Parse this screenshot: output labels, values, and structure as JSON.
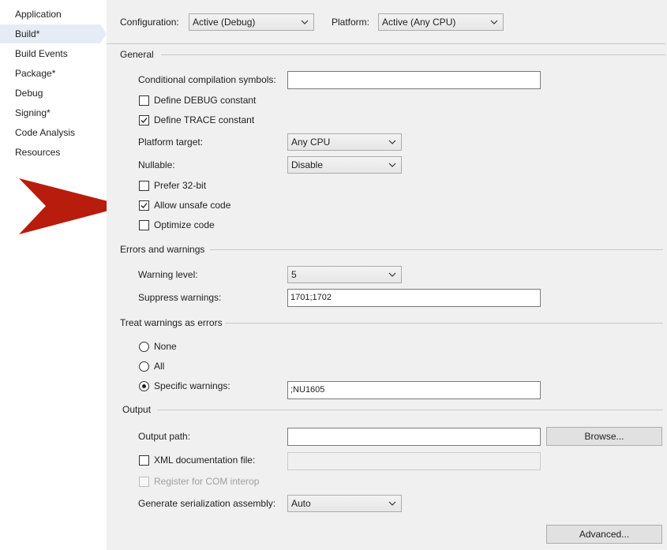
{
  "sidebar": {
    "items": [
      {
        "label": "Application"
      },
      {
        "label": "Build*"
      },
      {
        "label": "Build Events"
      },
      {
        "label": "Package*"
      },
      {
        "label": "Debug"
      },
      {
        "label": "Signing*"
      },
      {
        "label": "Code Analysis"
      },
      {
        "label": "Resources"
      }
    ],
    "selected_index": 1
  },
  "header": {
    "configuration_label": "Configuration:",
    "configuration_value": "Active (Debug)",
    "platform_label": "Platform:",
    "platform_value": "Active (Any CPU)"
  },
  "general": {
    "title": "General",
    "cond_symbols_label": "Conditional compilation symbols:",
    "cond_symbols_value": "",
    "define_debug": {
      "label": "Define DEBUG constant",
      "checked": false
    },
    "define_trace": {
      "label": "Define TRACE constant",
      "checked": true
    },
    "platform_target_label": "Platform target:",
    "platform_target_value": "Any CPU",
    "nullable_label": "Nullable:",
    "nullable_value": "Disable",
    "prefer32": {
      "label": "Prefer 32-bit",
      "checked": false
    },
    "allow_unsafe": {
      "label": "Allow unsafe code",
      "checked": true
    },
    "optimize": {
      "label": "Optimize code",
      "checked": false
    }
  },
  "errors": {
    "title": "Errors and warnings",
    "warning_level_label": "Warning level:",
    "warning_level_value": "5",
    "suppress_label": "Suppress warnings:",
    "suppress_value": "1701;1702"
  },
  "treat": {
    "title": "Treat warnings as errors",
    "none_label": "None",
    "all_label": "All",
    "specific_label": "Specific warnings:",
    "specific_value": ";NU1605",
    "selected": "specific"
  },
  "output": {
    "title": "Output",
    "path_label": "Output path:",
    "path_value": "",
    "browse_label": "Browse...",
    "xml_doc": {
      "label": "XML documentation file:",
      "checked": false
    },
    "xml_doc_value": "",
    "register_com": {
      "label": "Register for COM interop",
      "checked": false,
      "enabled": false
    },
    "serialization_label": "Generate serialization assembly:",
    "serialization_value": "Auto",
    "advanced_label": "Advanced..."
  },
  "colors": {
    "arrow": "#b81c0c",
    "sidebar_selected": "#e5ecf6",
    "panel_bg": "#f0f0f0"
  }
}
